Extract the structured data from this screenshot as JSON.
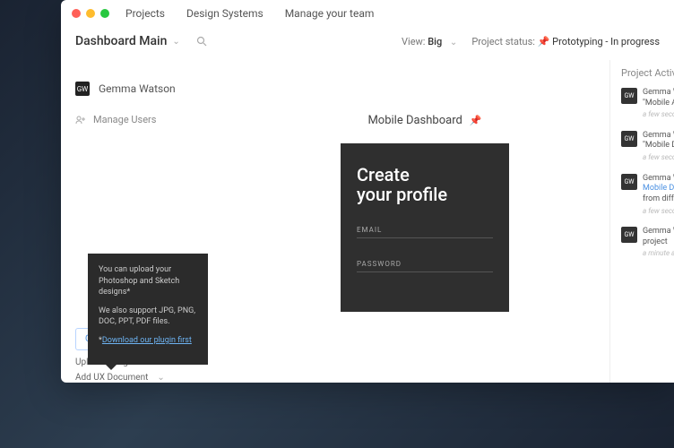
{
  "nav": {
    "projects": "Projects",
    "design_systems": "Design Systems",
    "manage_team": "Manage your team"
  },
  "header": {
    "title": "Dashboard Main",
    "view_label": "View:",
    "view_value": "Big",
    "status_label": "Project status:",
    "status_value": "Prototyping - In progress"
  },
  "sidebar": {
    "user": {
      "initials": "GW",
      "name": "Gemma Watson"
    },
    "manage_users": "Manage Users",
    "create_doc": "Cr",
    "upload_files": "Upload Design Files",
    "add_ux": "Add UX Document"
  },
  "main": {
    "doc_title": "Mobile Dashboard"
  },
  "mock": {
    "title_line1": "Create",
    "title_line2": "your profile",
    "email": "EMAIL",
    "password": "PASSWORD"
  },
  "activity": {
    "title": "Project Activity",
    "items": [
      {
        "initials": "GW",
        "name": "Gemma W",
        "desc": "\"Mobile A",
        "time": "a few seco"
      },
      {
        "initials": "GW",
        "name": "Gemma W",
        "desc": "\"Mobile D",
        "time": "a few seco"
      },
      {
        "initials": "GW",
        "name": "Gemma W",
        "link": "Mobile D",
        "desc": "from diff",
        "time": "a few seco"
      },
      {
        "initials": "GW",
        "name": "Gemma W",
        "desc": "project",
        "time": "a minute a"
      }
    ]
  },
  "tooltip": {
    "line1": "You can upload your Photoshop and Sketch designs*",
    "line2": "We also support JPG, PNG, DOC, PPT, PDF files.",
    "link_prefix": "*",
    "link": "Download our plugin first"
  }
}
